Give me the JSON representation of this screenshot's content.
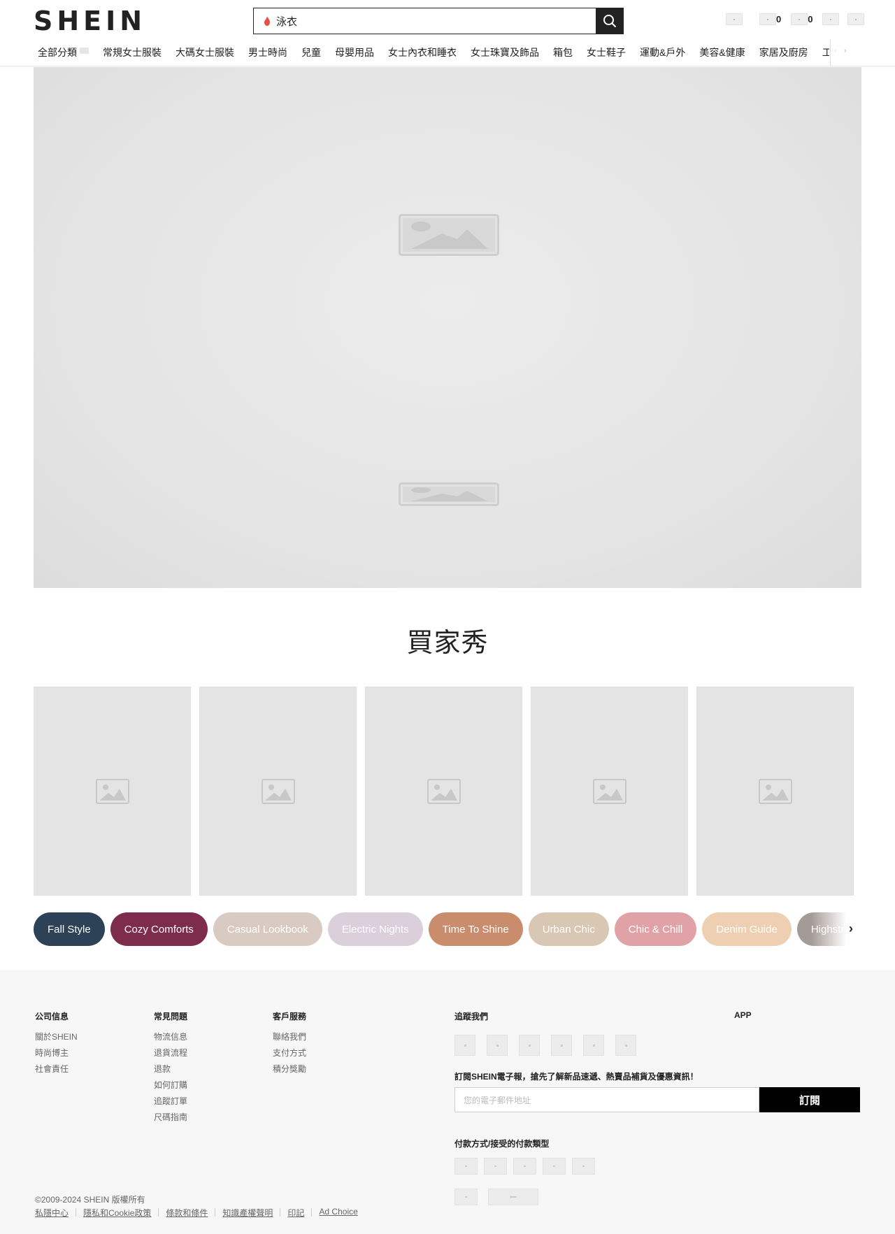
{
  "header": {
    "logo": "SHEIN",
    "search": {
      "value": "泳衣"
    },
    "icons": [
      {
        "name": "user-icon",
        "count": ""
      },
      {
        "name": "bag-icon",
        "count": "0"
      },
      {
        "name": "wishlist-icon",
        "count": "0"
      },
      {
        "name": "globe-icon",
        "count": ""
      },
      {
        "name": "help-icon",
        "count": ""
      }
    ]
  },
  "nav": {
    "items": [
      "全部分類",
      "常規女士服裝",
      "大碼女士服裝",
      "男士時尚",
      "兒童",
      "母嬰用品",
      "女士內衣和睡衣",
      "女士珠寶及飾品",
      "箱包",
      "女士鞋子",
      "運動&戶外",
      "美容&健康",
      "家居及廚房",
      "工具 & 家裝"
    ]
  },
  "buyer_show": {
    "title": "買家秀"
  },
  "pills": [
    {
      "label": "Fall Style",
      "bg": "#2e4257",
      "fg": "#ffffff"
    },
    {
      "label": "Cozy Comforts",
      "bg": "#7d2d4b",
      "fg": "#ffffff"
    },
    {
      "label": "Casual Lookbook",
      "bg": "#d9cbc2",
      "fg": "#ffffff"
    },
    {
      "label": "Electric Nights",
      "bg": "#dccfdc",
      "fg": "#ffffff"
    },
    {
      "label": "Time To Shine",
      "bg": "#c98c6d",
      "fg": "#ffffff"
    },
    {
      "label": "Urban Chic",
      "bg": "#d8c8b3",
      "fg": "#ffffff"
    },
    {
      "label": "Chic & Chill",
      "bg": "#e1a2a7",
      "fg": "#ffffff"
    },
    {
      "label": "Denim Guide",
      "bg": "#efcfb2",
      "fg": "#ffffff"
    },
    {
      "label": "Highstreet Fashion",
      "bg": "#a49a96",
      "fg": "#ffffff"
    }
  ],
  "footer": {
    "company": {
      "title": "公司信息",
      "links": [
        "關於SHEIN",
        "時尚博主",
        "社會責任"
      ]
    },
    "faq": {
      "title": "常見問題",
      "links": [
        "物流信息",
        "退貨流程",
        "退款",
        "如何訂購",
        "追蹤訂單",
        "尺碼指南"
      ]
    },
    "service": {
      "title": "客戶服務",
      "links": [
        "聯絡我們",
        "支付方式",
        "積分獎勵"
      ]
    },
    "follow_title": "追蹤我們",
    "app_title": "APP",
    "app_icons": [
      "",
      ""
    ],
    "subscribe_text": "訂閱SHEIN電子報，搶先了解新品速遞、熱賣品補貨及優惠資訊！",
    "email_placeholder": "您的電子郵件地址",
    "subscribe_button": "訂閱",
    "payment_title": "付款方式/接受的付款類型",
    "copyright": "©2009-2024 SHEIN 版權所有",
    "legal": [
      "私隱中心",
      "隱私和Cookie政策",
      "條款和條件",
      "知識產權聲明",
      "印記",
      "Ad Choice"
    ]
  },
  "colors": {
    "accent": "#222222",
    "flame": "#e8504a"
  }
}
